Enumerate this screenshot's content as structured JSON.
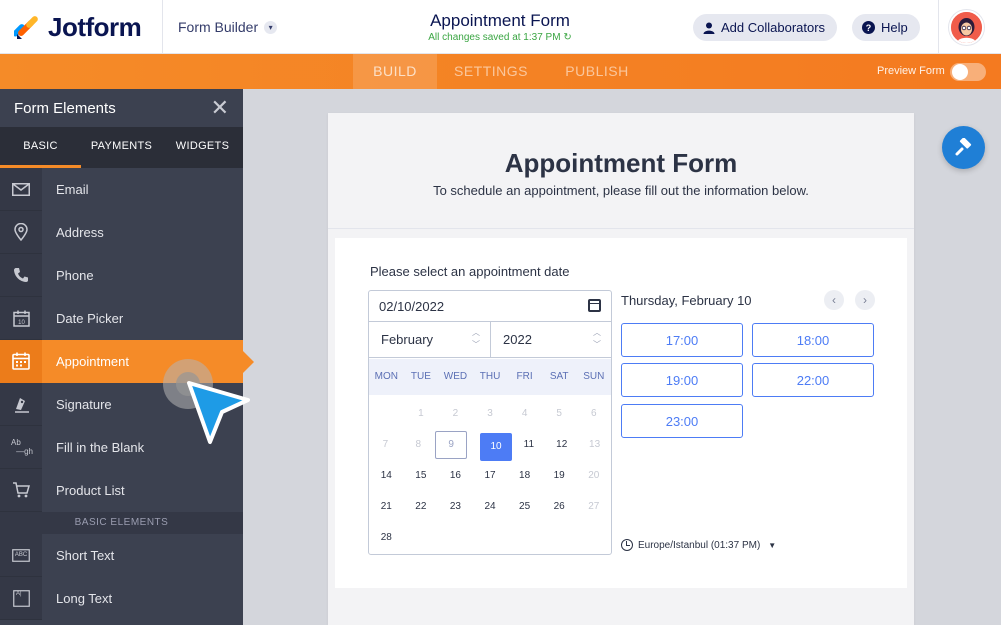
{
  "header": {
    "logo_text": "Jotform",
    "builder_label": "Form Builder",
    "form_title": "Appointment Form",
    "save_status": "All changes saved at 1:37 PM",
    "collaborators_label": "Add Collaborators",
    "help_label": "Help"
  },
  "nav": {
    "tabs": [
      "BUILD",
      "SETTINGS",
      "PUBLISH"
    ],
    "active_tab": "BUILD",
    "preview_label": "Preview Form",
    "accent_color": "#f58b28"
  },
  "panel": {
    "title": "Form Elements",
    "tabs": [
      "BASIC",
      "PAYMENTS",
      "WIDGETS"
    ],
    "items": [
      {
        "label": "Email",
        "icon": "envelope-icon"
      },
      {
        "label": "Address",
        "icon": "map-pin-icon"
      },
      {
        "label": "Phone",
        "icon": "phone-icon"
      },
      {
        "label": "Date Picker",
        "icon": "calendar-icon"
      },
      {
        "label": "Appointment",
        "icon": "appointment-icon"
      },
      {
        "label": "Signature",
        "icon": "pen-icon"
      },
      {
        "label": "Fill in the Blank",
        "icon": "fill-blank-icon"
      },
      {
        "label": "Product List",
        "icon": "cart-icon"
      }
    ],
    "section_label": "BASIC ELEMENTS",
    "items2": [
      {
        "label": "Short Text",
        "icon": "short-text-icon"
      },
      {
        "label": "Long Text",
        "icon": "long-text-icon"
      }
    ],
    "icon_glyphs": {
      "fill_blank_top": "Ab",
      "fill_blank_bottom": "gh",
      "short_text": "ABC",
      "long_text": "A|"
    }
  },
  "form": {
    "title": "Appointment Form",
    "subtitle": "To schedule an appointment, please fill out the information below.",
    "question": "Please select an appointment date",
    "date_value": "02/10/2022",
    "month": "February",
    "year": "2022",
    "weekdays": [
      "MON",
      "TUE",
      "WED",
      "THU",
      "FRI",
      "SAT",
      "SUN"
    ],
    "weeks": [
      [
        {
          "d": "",
          "s": ""
        },
        {
          "d": "1",
          "s": "muted"
        },
        {
          "d": "2",
          "s": "muted"
        },
        {
          "d": "3",
          "s": "muted"
        },
        {
          "d": "4",
          "s": "muted"
        },
        {
          "d": "5",
          "s": "muted"
        },
        {
          "d": "6",
          "s": "muted"
        }
      ],
      [
        {
          "d": "7",
          "s": "muted"
        },
        {
          "d": "8",
          "s": "muted"
        },
        {
          "d": "9",
          "s": "today"
        },
        {
          "d": "10",
          "s": "sel"
        },
        {
          "d": "11",
          "s": ""
        },
        {
          "d": "12",
          "s": ""
        },
        {
          "d": "13",
          "s": "muted"
        }
      ],
      [
        {
          "d": "14",
          "s": ""
        },
        {
          "d": "15",
          "s": ""
        },
        {
          "d": "16",
          "s": ""
        },
        {
          "d": "17",
          "s": ""
        },
        {
          "d": "18",
          "s": ""
        },
        {
          "d": "19",
          "s": ""
        },
        {
          "d": "20",
          "s": "muted"
        }
      ],
      [
        {
          "d": "21",
          "s": ""
        },
        {
          "d": "22",
          "s": ""
        },
        {
          "d": "23",
          "s": ""
        },
        {
          "d": "24",
          "s": ""
        },
        {
          "d": "25",
          "s": ""
        },
        {
          "d": "26",
          "s": ""
        },
        {
          "d": "27",
          "s": "muted"
        }
      ],
      [
        {
          "d": "28",
          "s": ""
        },
        {
          "d": "",
          "s": ""
        },
        {
          "d": "",
          "s": ""
        },
        {
          "d": "",
          "s": ""
        },
        {
          "d": "",
          "s": ""
        },
        {
          "d": "",
          "s": ""
        },
        {
          "d": "",
          "s": ""
        }
      ]
    ],
    "selected_date_text": "Thursday, February 10",
    "prev_glyph": "‹",
    "next_glyph": "›",
    "time_slots": [
      "17:00",
      "18:00",
      "19:00",
      "22:00",
      "23:00"
    ],
    "timezone": "Europe/Istanbul (01:37 PM)",
    "timezone_caret": "▼",
    "slot_color": "#4d7cf5"
  }
}
